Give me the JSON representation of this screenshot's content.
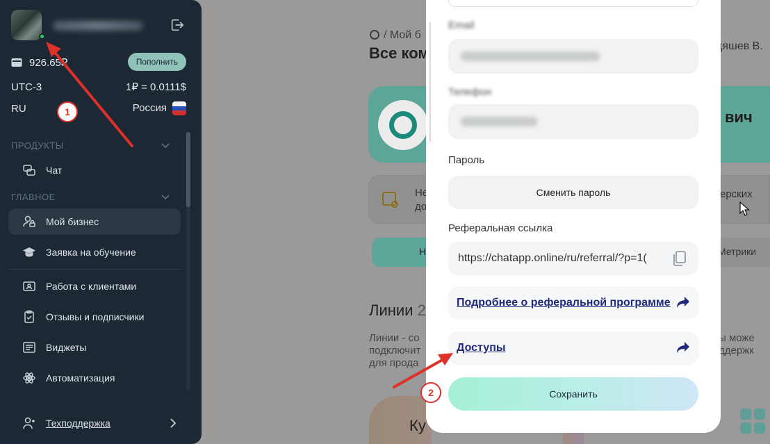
{
  "sidebar": {
    "balance": "926.65₽",
    "topup_label": "Пополнить",
    "timezone": "UTC-3",
    "rate": "1₽ = 0.0111$",
    "lang": "RU",
    "country": "Россия",
    "sections": {
      "products": "ПРОДУКТЫ",
      "main": "ГЛАВНОЕ"
    },
    "items": {
      "chat": "Чат",
      "my_business": "Мой бизнес",
      "training": "Заявка на обучение",
      "clients": "Работа с клиентами",
      "reviews": "Отзывы и подписчики",
      "widgets": "Виджеты",
      "automation": "Автоматизация",
      "support": "Техподдержка"
    }
  },
  "background": {
    "breadcrumb": "/ Мой б",
    "title": "Все ком",
    "user_name": "дяшев В.",
    "name_suffix": "вич",
    "notice": "Не",
    "notice2": "до",
    "notice_right": "ерских",
    "tab_left": "Н",
    "tab_right": "Метрики",
    "lines_title": "Линии",
    "lines_count": "2",
    "lines_desc_1": "Линии - со",
    "lines_desc_2": "подключит",
    "lines_desc_3": "для прода",
    "lines_desc_r1": "ы може",
    "lines_desc_r2": "ддержк",
    "bottom_card": "Ку"
  },
  "modal": {
    "email_label": "Email",
    "phone_label": "Телефон",
    "password_label": "Пароль",
    "change_password": "Сменить пароль",
    "referral_label": "Реферальная ссылка",
    "referral_url": "https://chatapp.online/ru/referral/?p=1(",
    "referral_more": "Подробнее о реферальной программе",
    "access": "Доступы",
    "save": "Сохранить"
  },
  "annotations": {
    "badge_1": "1",
    "badge_2": "2"
  },
  "colors": {
    "sidebar_bg": "#1c2833",
    "accent_red": "#e0302a",
    "topup_bg": "#8fc2b8"
  }
}
